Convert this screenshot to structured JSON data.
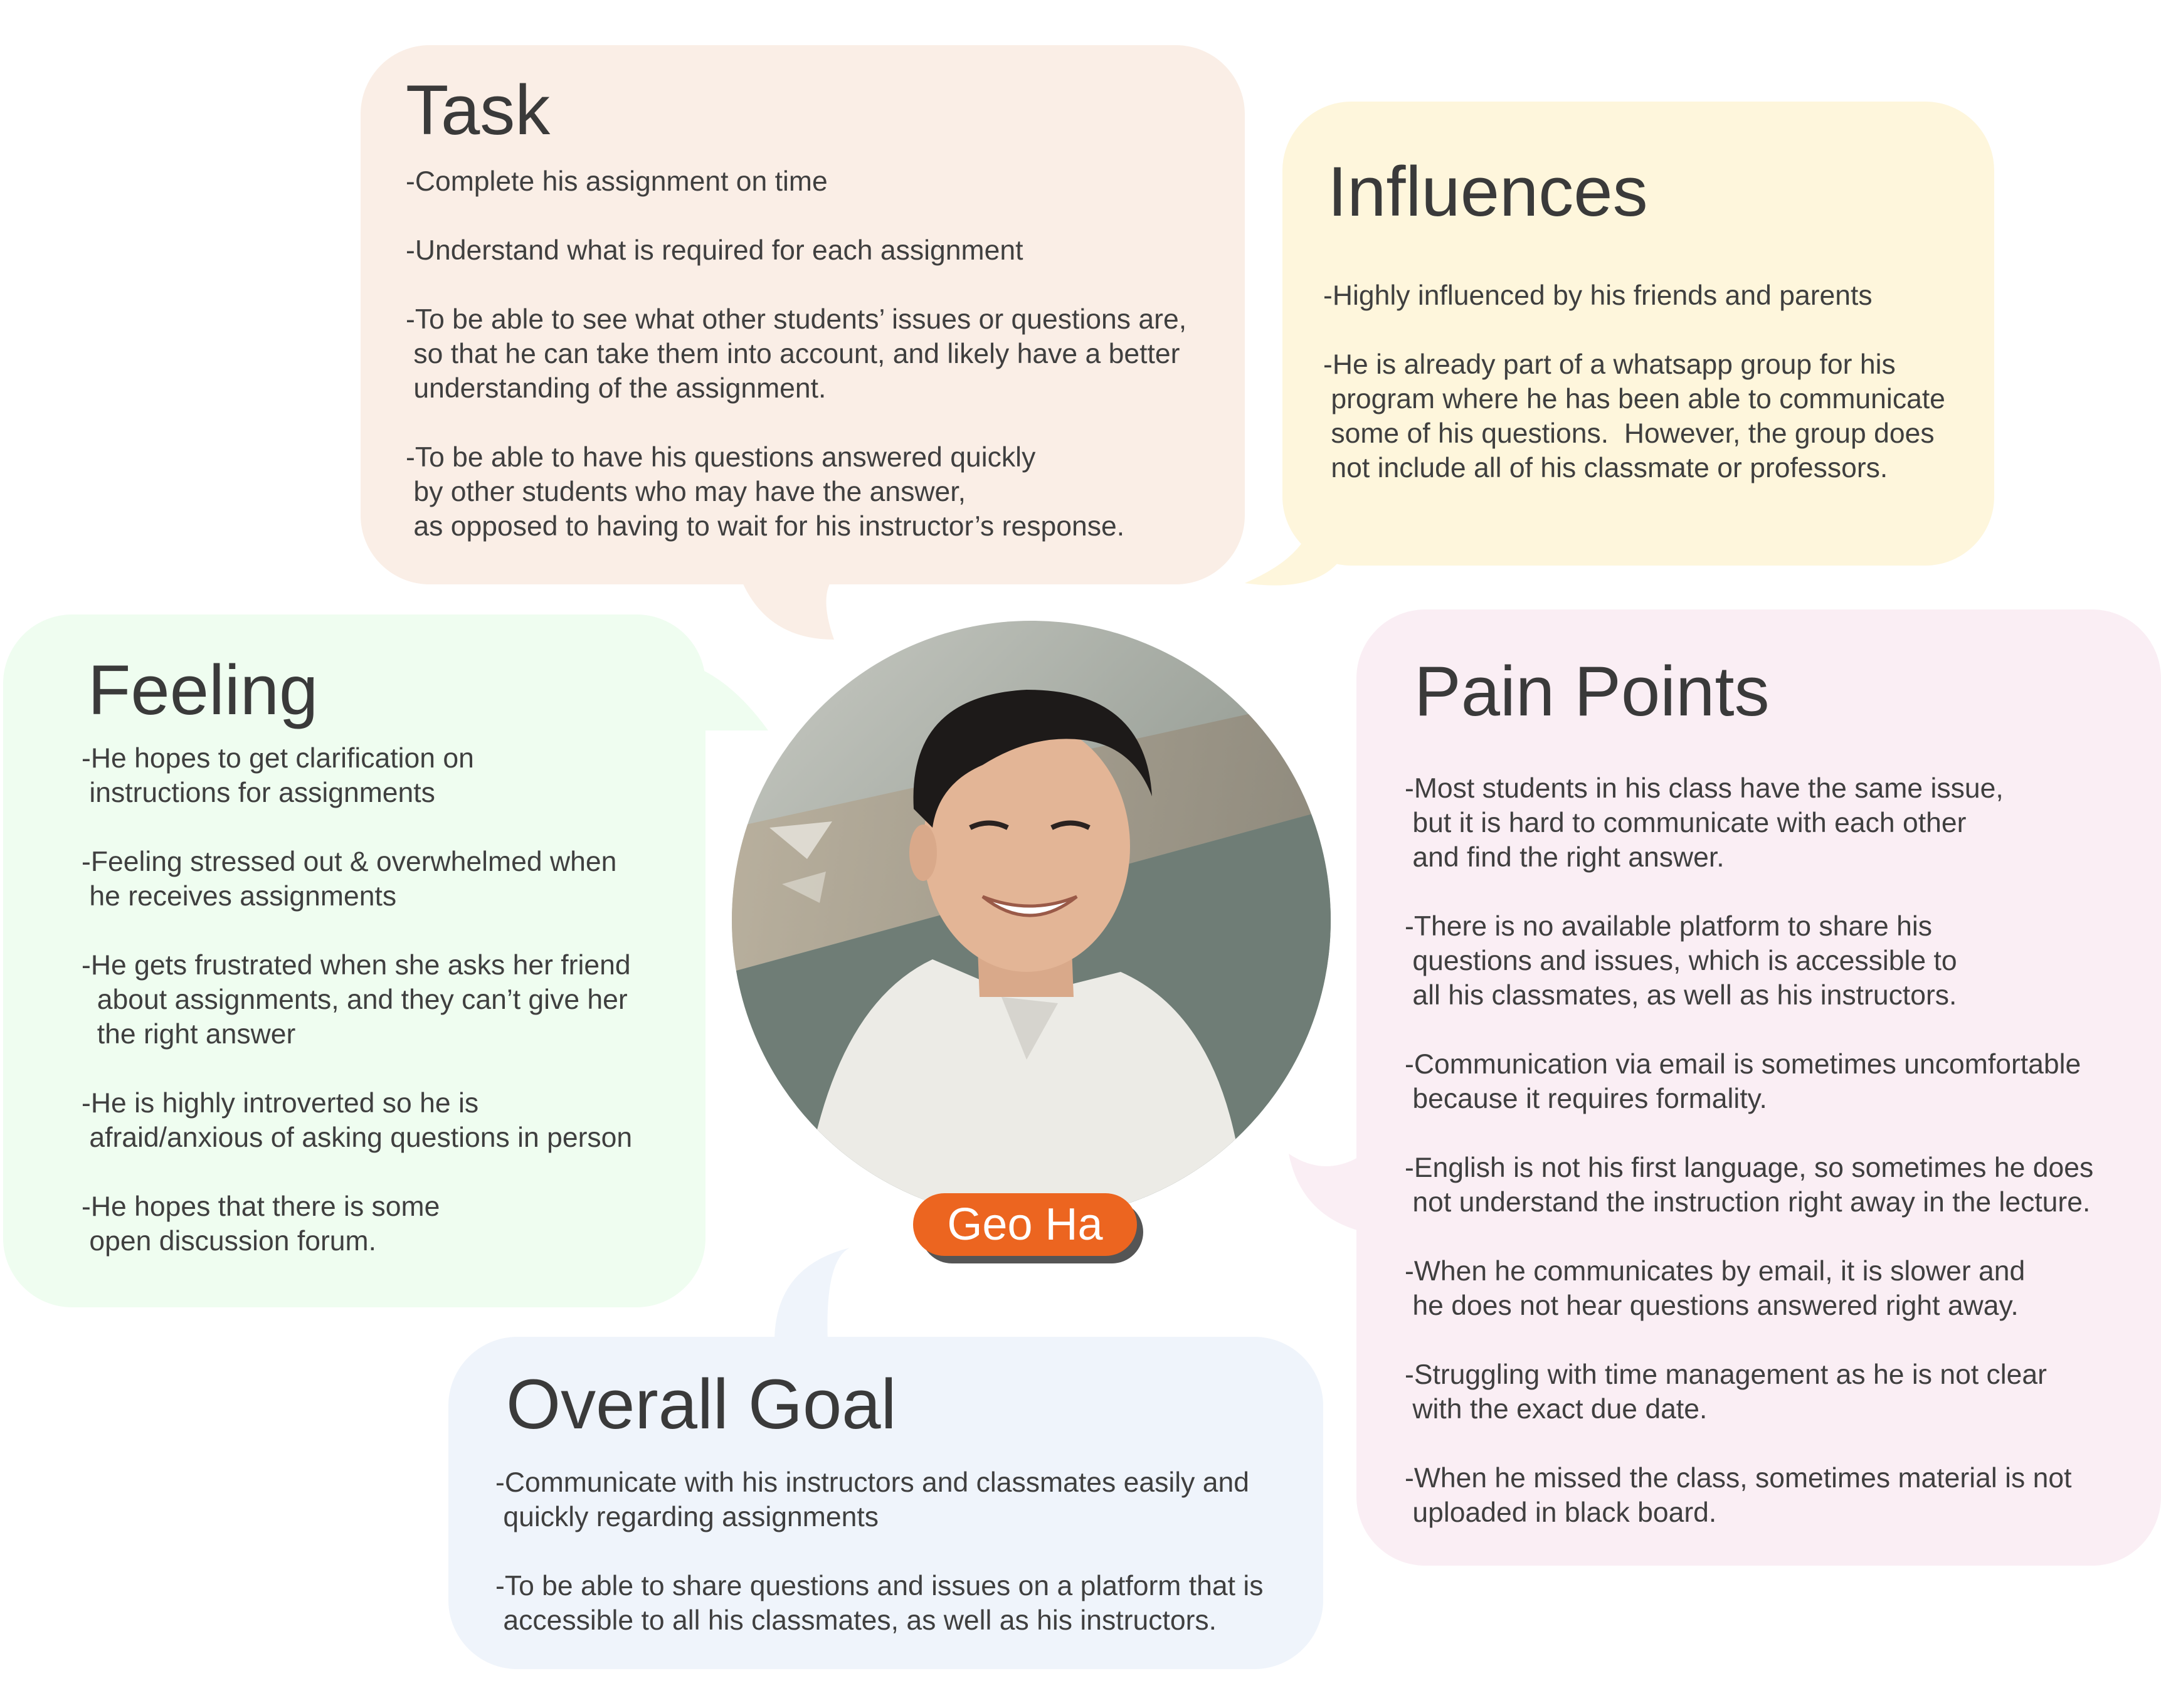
{
  "task": {
    "title": "Task",
    "lines": [
      "-Complete his assignment on time",
      "",
      "-Understand what is required for each assignment",
      "",
      "-To be able to see what other students’ issues or questions are,",
      " so that he can take them into account, and likely have a better",
      " understanding of the assignment.",
      "",
      "-To be able to have his questions answered quickly",
      " by other students who may have the answer,",
      " as opposed to having to wait for his instructor’s response."
    ]
  },
  "influences": {
    "title": "Influences",
    "lines": [
      "-Highly influenced by his friends and parents",
      "",
      "-He is already part of a whatsapp group for his",
      " program where he has been able to communicate",
      " some of his questions.  However, the group does",
      " not include all of his classmate or professors."
    ]
  },
  "feeling": {
    "title": "Feeling",
    "lines": [
      "-He hopes to get clarification on",
      " instructions for assignments",
      "",
      "-Feeling stressed out & overwhelmed when",
      " he receives assignments",
      "",
      "-He gets frustrated when she asks her friend",
      "  about assignments, and they can’t give her",
      "  the right answer",
      "",
      "-He is highly introverted so he is",
      " afraid/anxious of asking questions in person",
      "",
      "-He hopes that there is some",
      " open discussion forum."
    ]
  },
  "pain_points": {
    "title": "Pain Points",
    "lines": [
      "-Most students in his class have the same issue,",
      " but it is hard to communicate with each other",
      " and find the right answer.",
      "",
      "-There is no available platform to share his",
      " questions and issues, which is accessible to",
      " all his classmates, as well as his instructors.",
      "",
      "-Communication via email is sometimes uncomfortable",
      " because it requires formality.",
      "",
      "-English is not his first language, so sometimes he does",
      " not understand the instruction right away in the lecture.",
      "",
      "-When he communicates by email, it is slower and",
      " he does not hear questions answered right away.",
      "",
      "-Struggling with time management as he is not clear",
      " with the exact due date.",
      "",
      "-When he missed the class, sometimes material is not",
      " uploaded in black board."
    ]
  },
  "overall_goal": {
    "title": "Overall Goal",
    "lines": [
      "-Communicate with his instructors and classmates easily and",
      " quickly regarding assignments",
      "",
      "-To be able to share questions and issues on a platform that is",
      " accessible to all his classmates, as well as his instructors."
    ]
  },
  "persona": {
    "name": "Geo Ha",
    "photo_icon": "person-photo-icon",
    "badge_color": "#ec6520"
  },
  "colors": {
    "task": "#faeee6",
    "influences": "#fef6dc",
    "feeling": "#effdf0",
    "pain_points": "#faeef4",
    "overall_goal": "#eff4fb"
  }
}
